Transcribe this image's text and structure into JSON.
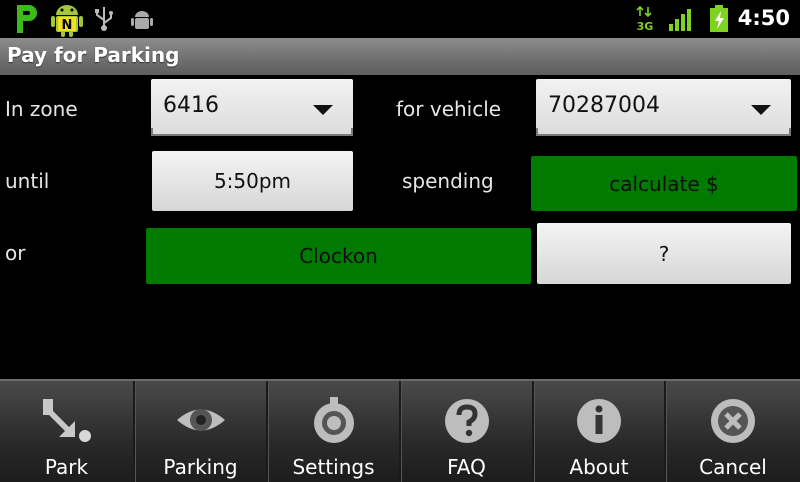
{
  "status_bar": {
    "time": "4:50",
    "network_label": "3G",
    "icons": [
      "parking-app-icon",
      "android-n-icon",
      "usb-icon",
      "debug-icon",
      "network-3g-icon",
      "signal-icon",
      "battery-charging-icon"
    ],
    "notification_letter": "N"
  },
  "title": "Pay for Parking",
  "form": {
    "zone_label": "In zone",
    "zone_value": "6416",
    "vehicle_label": "for vehicle",
    "vehicle_value": "70287004",
    "until_label": "until",
    "until_value": "5:50pm",
    "spending_label": "spending",
    "calculate_label": "calculate $",
    "or_label": "or",
    "clockon_label": "Clockon",
    "help_label": "?"
  },
  "menu": [
    {
      "label": "Park",
      "icon": "park-arrow-icon"
    },
    {
      "label": "Parking",
      "icon": "eye-icon"
    },
    {
      "label": "Settings",
      "icon": "gear-icon"
    },
    {
      "label": "FAQ",
      "icon": "question-icon"
    },
    {
      "label": "About",
      "icon": "info-icon"
    },
    {
      "label": "Cancel",
      "icon": "cancel-icon"
    }
  ],
  "colors": {
    "green_button": "#007a00",
    "status_green": "#7ed321"
  }
}
